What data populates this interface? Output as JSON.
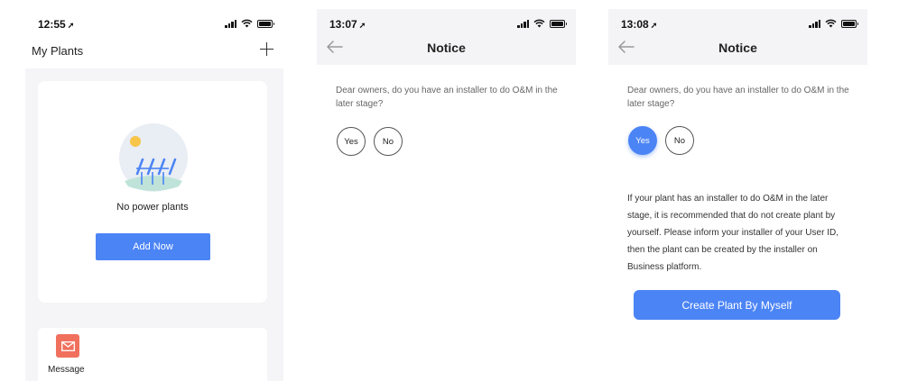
{
  "screens": {
    "plants": {
      "status_time": "12:55",
      "title": "My Plants",
      "empty_text": "No power plants",
      "add_button": "Add Now",
      "message_label": "Message",
      "icons": [
        "location-arrow-icon",
        "signal-icon",
        "wifi-icon",
        "battery-icon",
        "plus-icon",
        "solar-plant-illustration",
        "envelope-icon"
      ]
    },
    "notice_initial": {
      "status_time": "13:07",
      "title": "Notice",
      "question": "Dear owners, do you have an installer to do O&M in the later stage?",
      "options": [
        "Yes",
        "No"
      ],
      "selected": null
    },
    "notice_yes": {
      "status_time": "13:08",
      "title": "Notice",
      "question": "Dear owners, do you have an installer to do O&M in the later stage?",
      "options": [
        "Yes",
        "No"
      ],
      "selected": "Yes",
      "advice": "If your plant has an installer to do O&M in the later stage, it is recommended that do not create plant by yourself. Please inform your installer of your User ID, then the plant can be created by the installer on Business platform.",
      "create_button": "Create Plant By Myself"
    }
  },
  "colors": {
    "accent": "#4b84f5",
    "message_icon_bg": "#f0705d",
    "page_bg": "#f5f5f7",
    "header_bg": "#f4f4f6"
  }
}
